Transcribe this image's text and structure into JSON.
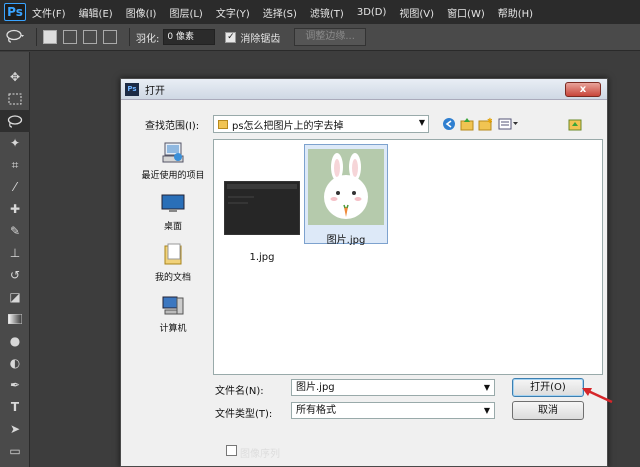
{
  "app": {
    "logo": "Ps"
  },
  "menu": [
    "文件(F)",
    "编辑(E)",
    "图像(I)",
    "图层(L)",
    "文字(Y)",
    "选择(S)",
    "滤镜(T)",
    "3D(D)",
    "视图(V)",
    "窗口(W)",
    "帮助(H)"
  ],
  "options": {
    "feather_label": "羽化:",
    "feather_value": "0 像素",
    "antialias_label": "消除锯齿",
    "antialias_checked": true,
    "refine_edge": "调整边缘..."
  },
  "tools": [
    "move-tool",
    "marquee-tool",
    "lasso-tool",
    "magic-wand-tool",
    "crop-tool",
    "eyedropper-tool",
    "healing-brush-tool",
    "brush-tool",
    "clone-stamp-tool",
    "history-brush-tool",
    "eraser-tool",
    "gradient-tool",
    "blur-tool",
    "dodge-tool",
    "pen-tool",
    "type-tool",
    "path-selection-tool",
    "shape-tool"
  ],
  "dialog": {
    "title": "打开",
    "close": "x",
    "lookin_label": "查找范围(I):",
    "lookin_value": "ps怎么把图片上的字去掉",
    "places": [
      {
        "icon": "recent-icon",
        "label": "最近使用的项目"
      },
      {
        "icon": "desktop-icon",
        "label": "桌面"
      },
      {
        "icon": "documents-icon",
        "label": "我的文档"
      },
      {
        "icon": "computer-icon",
        "label": "计算机"
      }
    ],
    "files": [
      {
        "name": "1.jpg",
        "selected": false
      },
      {
        "name": "图片.jpg",
        "selected": true
      }
    ],
    "filename_label": "文件名(N):",
    "filename_value": "图片.jpg",
    "filetype_label": "文件类型(T):",
    "filetype_value": "所有格式",
    "open_button": "打开(O)",
    "cancel_button": "取消",
    "image_sequence_label": "图像序列"
  },
  "colors": {
    "accent_red": "#d6262a",
    "selection_blue": "#dde9f8"
  }
}
